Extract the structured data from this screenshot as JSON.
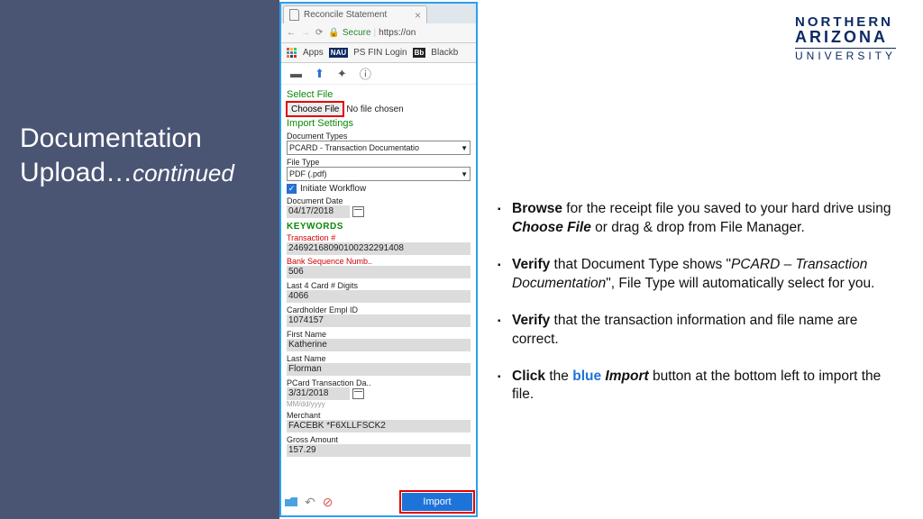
{
  "sidebar": {
    "title_line1": "Documentation",
    "title_line2": "Upload…",
    "title_cont": "continued"
  },
  "logo": {
    "l1": "NORTHERN",
    "l2": "ARIZONA",
    "l3": "UNIVERSITY"
  },
  "browser": {
    "tab_title": "Reconcile Statement",
    "url_secure": "Secure",
    "url_text": "https://on",
    "bookmarks": {
      "apps": "Apps",
      "ps": "PS FIN Login",
      "bb": "Blackb"
    }
  },
  "panel": {
    "select_file": "Select File",
    "choose_file": "Choose File",
    "no_file": "No file chosen",
    "import_settings": "Import Settings",
    "doc_types_lbl": "Document Types",
    "doc_types_val": "PCARD - Transaction Documentatio",
    "file_type_lbl": "File Type",
    "file_type_val": "PDF (.pdf)",
    "initiate": "Initiate Workflow",
    "doc_date_lbl": "Document Date",
    "doc_date_val": "04/17/2018",
    "keywords": "KEYWORDS",
    "fields": [
      {
        "label": "Transaction #",
        "value": "24692168090100232291408",
        "red": true
      },
      {
        "label": "Bank Sequence Numb..",
        "value": "506",
        "red": true
      },
      {
        "label": "Last 4 Card # Digits",
        "value": "4066"
      },
      {
        "label": "Cardholder Empl ID",
        "value": "1074157"
      },
      {
        "label": "First Name",
        "value": "Katherine"
      },
      {
        "label": "Last Name",
        "value": "Florman"
      },
      {
        "label": "PCard Transaction Da..",
        "value": "3/31/2018",
        "date": true,
        "hint": "MM/dd/yyyy"
      },
      {
        "label": "Merchant",
        "value": "FACEBK *F6XLLFSCK2"
      },
      {
        "label": "Gross Amount",
        "value": "157.29"
      }
    ],
    "import_btn": "Import"
  },
  "instr": {
    "i1": {
      "b": "Browse",
      "t1": " for the receipt file you saved to your hard drive using ",
      "bi": "Choose File",
      "t2": " or drag & drop from File Manager."
    },
    "i2": {
      "b": "Verify",
      "t1": " that Document Type shows \"",
      "i": "PCARD – Transaction Documentation",
      "t2": "\", File Type will automatically select for you."
    },
    "i3": {
      "b": "Verify",
      "t1": " that the transaction information and file name are correct."
    },
    "i4": {
      "b": "Click",
      "t1": " the ",
      "blue": "blue",
      "t2": " ",
      "bi": "Import",
      "t3": " button at the bottom left to import the file."
    }
  }
}
